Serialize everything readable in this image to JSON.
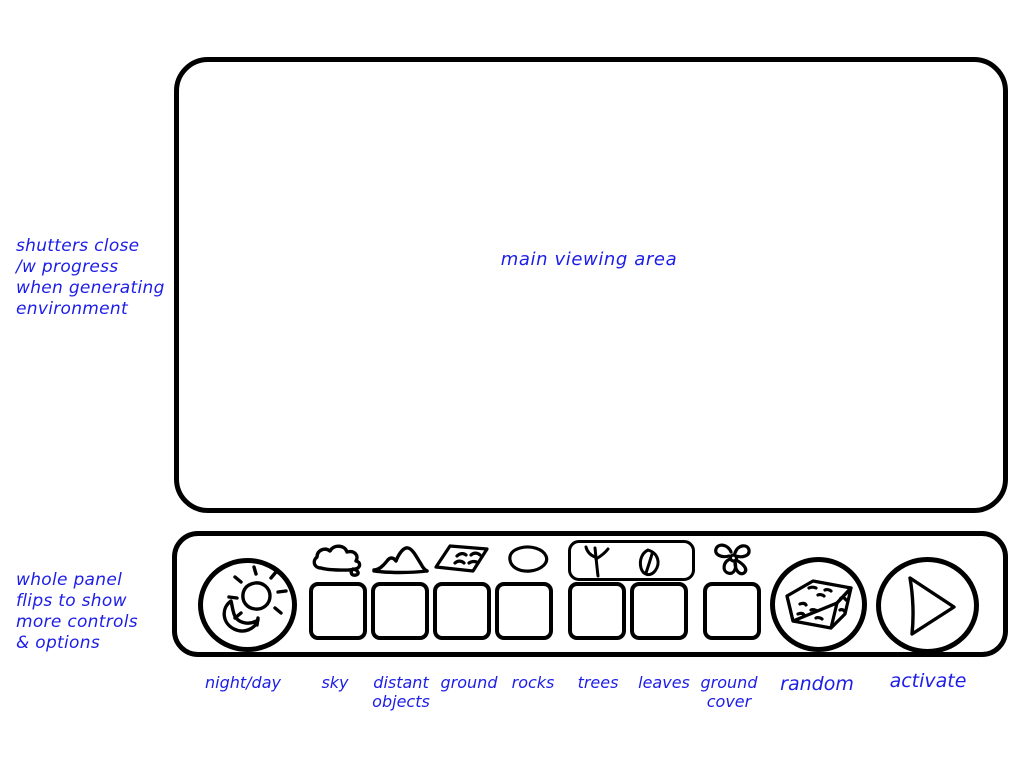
{
  "annotations": {
    "shutters": "shutters close\n/w progress\nwhen generating\nenvironment",
    "panel_flip": "whole panel\nflips to show\nmore controls\n& options"
  },
  "viewing_area": {
    "label": "main viewing area"
  },
  "control_panel": {
    "controls": [
      {
        "name": "night-day",
        "label": "night/day",
        "icon": "sun-moon-icon",
        "type": "round-button"
      },
      {
        "name": "sky",
        "label": "sky",
        "icon": "cloud-icon",
        "type": "square-slot"
      },
      {
        "name": "distant-objects",
        "label": "distant\nobjects",
        "icon": "mountain-icon",
        "type": "square-slot"
      },
      {
        "name": "ground",
        "label": "ground",
        "icon": "ground-plane-icon",
        "type": "square-slot"
      },
      {
        "name": "rocks",
        "label": "rocks",
        "icon": "rock-icon",
        "type": "square-slot"
      },
      {
        "name": "trees",
        "label": "trees",
        "icon": "sapling-icon",
        "type": "square-slot"
      },
      {
        "name": "leaves",
        "label": "leaves",
        "icon": "leaf-icon",
        "type": "square-slot"
      },
      {
        "name": "ground-cover",
        "label": "ground\ncover",
        "icon": "flower-icon",
        "type": "square-slot"
      },
      {
        "name": "random",
        "label": "random",
        "icon": "dice-cube-icon",
        "type": "round-button"
      },
      {
        "name": "activate",
        "label": "activate",
        "icon": "play-triangle-icon",
        "type": "round-button"
      }
    ]
  },
  "colors": {
    "ink": "#000000",
    "annotation_blue": "#1d1de8",
    "background": "#ffffff"
  }
}
